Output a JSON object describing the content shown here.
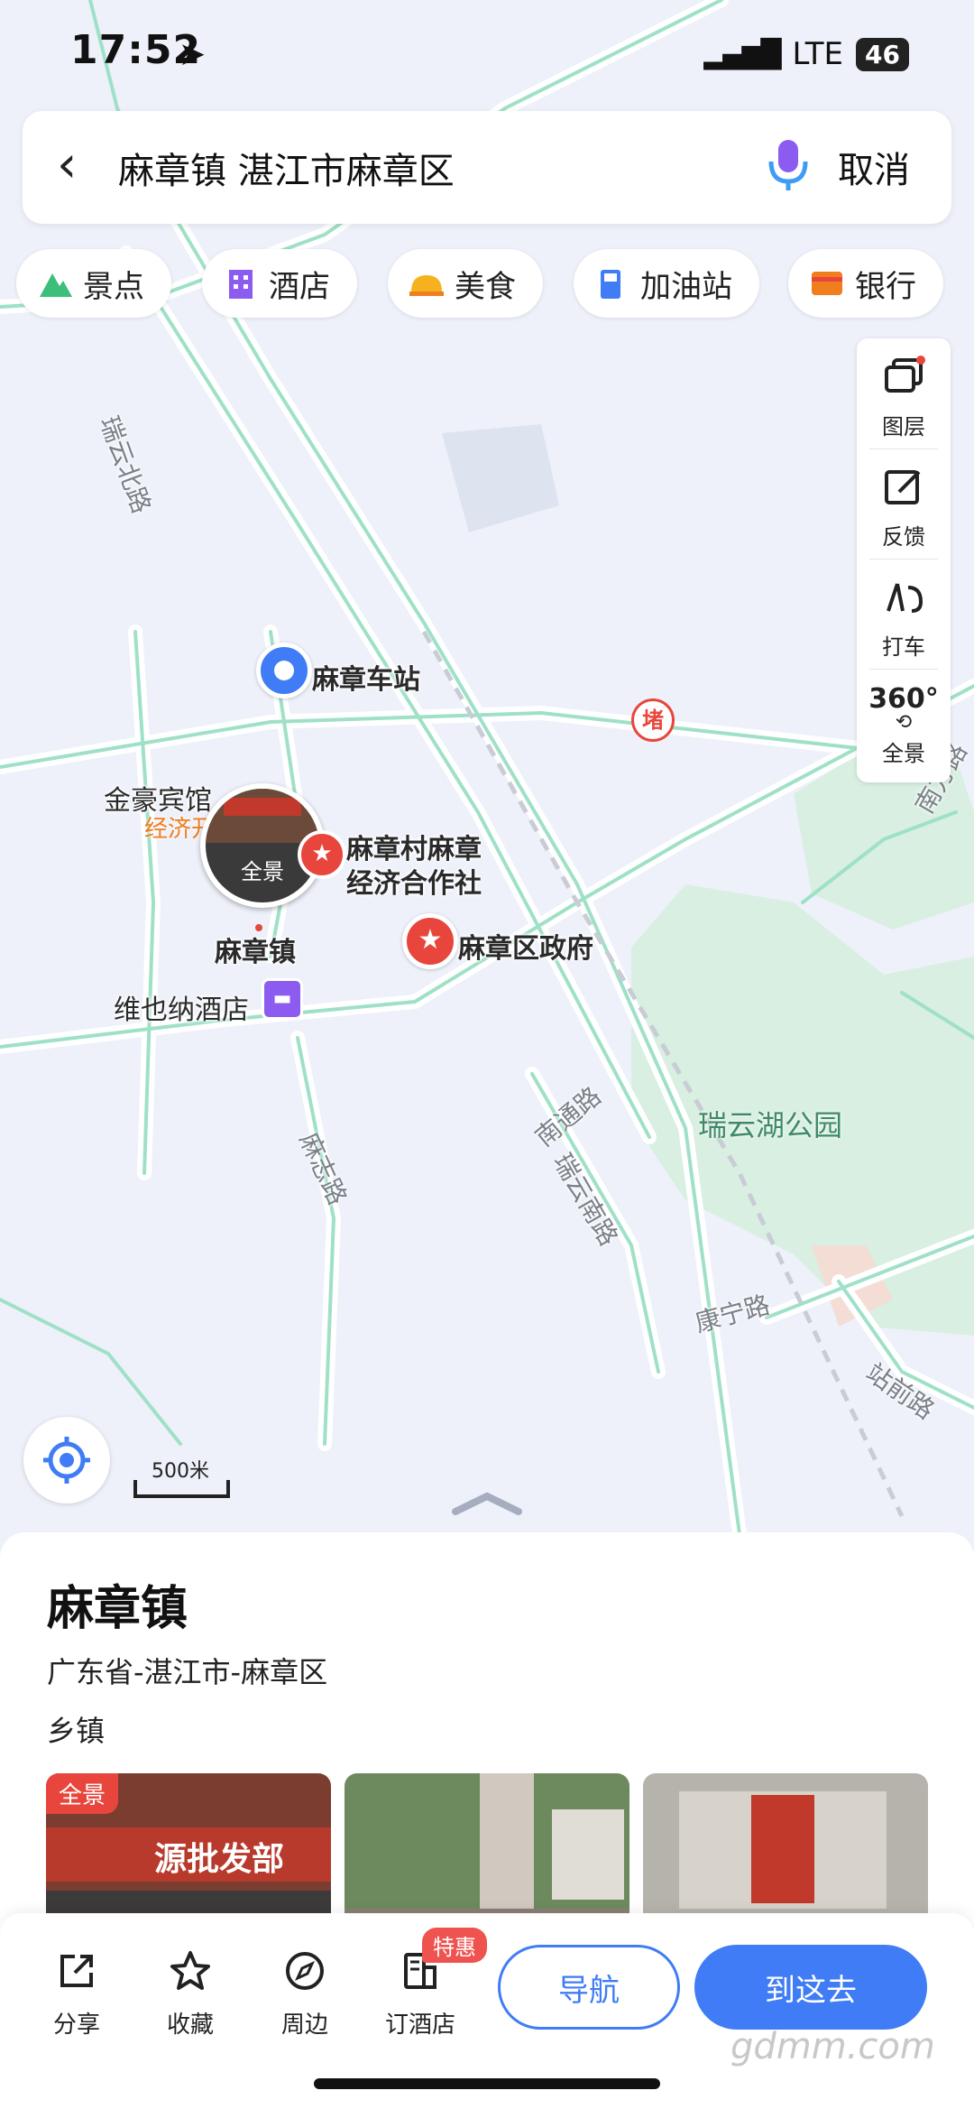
{
  "status": {
    "time": "17:52",
    "network": "LTE",
    "battery": "46"
  },
  "search": {
    "query": "麻章镇 湛江市麻章区",
    "cancel": "取消"
  },
  "chips": [
    "景点",
    "酒店",
    "美食",
    "加油站",
    "银行"
  ],
  "tools": [
    "图层",
    "反馈",
    "打车",
    "全景"
  ],
  "tools_360": "360°",
  "map": {
    "poi_station": "麻章车站",
    "poi_hotel_top": "金豪宾馆",
    "poi_orange": "经济开",
    "poi_coop_1": "麻章村麻章",
    "poi_coop_2": "经济合作社",
    "poi_gov": "麻章区政府",
    "poi_town": "麻章镇",
    "poi_vienna": "维也纳酒店",
    "poi_park": "瑞云湖公园",
    "pano_bubble": "全景",
    "road_ruiyun_north": "瑞云北路",
    "road_nantong": "南通路",
    "road_ruiyun_south": "瑞云南路",
    "road_mazhi": "麻志路",
    "road_kangning": "康宁路",
    "road_zhanqian": "站前路",
    "road_nanfang": "南方路",
    "jam_tag": "堵",
    "scale": "500米"
  },
  "place": {
    "title": "麻章镇",
    "address": "广东省-湛江市-麻章区",
    "type": "乡镇",
    "pano_tag": "全景",
    "photo_sign": "源批发部"
  },
  "actions": {
    "share": "分享",
    "collect": "收藏",
    "nearby": "周边",
    "hotel": "订酒店",
    "hotel_badge": "特惠",
    "navigate": "导航",
    "go_here": "到这去"
  },
  "watermark": "gdmm.com",
  "colors": {
    "accent": "#3f7cf5",
    "road": "#9fe0c8",
    "park": "#d6f0e3",
    "poi_red": "#e8463c"
  }
}
